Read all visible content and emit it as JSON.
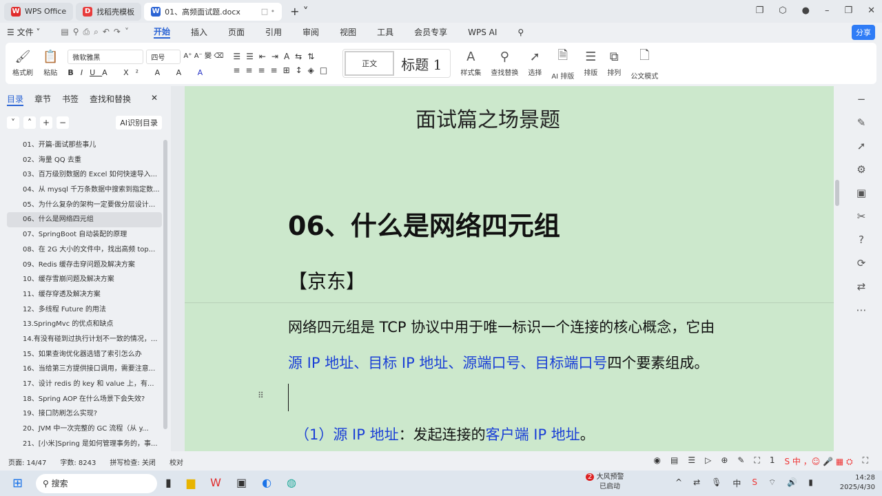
{
  "tabs": [
    {
      "label": "WPS Office",
      "color": "#e02b2b",
      "logo": "W"
    },
    {
      "label": "找稻壳模板",
      "color": "#e83c3c",
      "logo": "D"
    },
    {
      "label": "01、高频面试题.docx",
      "color": "#2a63d4",
      "logo": "W"
    }
  ],
  "menu": {
    "file": "文件",
    "items": [
      "开始",
      "插入",
      "页面",
      "引用",
      "审阅",
      "视图",
      "工具",
      "会员专享",
      "WPS AI"
    ],
    "active": "开始",
    "share": "分享"
  },
  "ribbon": {
    "format_painter": "格式刷",
    "paste": "粘贴",
    "font": "微软雅黑",
    "size": "四号",
    "style_normal": "正文",
    "style_h1": "标题 1",
    "style_set": "样式集",
    "find_replace": "查找替换",
    "select": "选择",
    "ai_layout": "AI 排版",
    "layout": "排版",
    "arrange": "排列",
    "doc_mode": "公文模式"
  },
  "sidebar": {
    "tabs": [
      "目录",
      "章节",
      "书签",
      "查找和替换"
    ],
    "ai_toc": "AI识别目录",
    "items": [
      "01、开篇-面试那些事儿",
      "02、海量 QQ 去重",
      "03、百万级别数据的 Excel 如何快速导入...",
      "04、从 mysql 千万条数据中搜索到指定数...",
      "05、为什么复杂的架构一定要做分层设计...",
      "06、什么是网络四元组",
      "07、SpringBoot 自动装配的原理",
      "08、在 2G 大小的文件中，找出高频 top...",
      "09、Redis 缓存击穿问题及解决方案",
      "10、缓存雪崩问题及解决方案",
      "11、缓存穿透及解决方案",
      "12、多线程 Future 的用法",
      "13.SpringMvc 的优点和缺点",
      "14.有没有碰到过执行计划不一致的情况，...",
      "15、如果查询优化器选错了索引怎么办",
      "16、当给第三方提供接口调用，需要注意...",
      "17、设计 redis 的 key 和 value 上，有...",
      "18、Spring AOP 在什么场景下会失效?",
      "19、接口防刷怎么实现?",
      "20、JVM 中一次完整的 GC 流程（从 y...",
      "21、[小米]Spring 是如何管理事务的，事..."
    ],
    "current_index": 5
  },
  "document": {
    "section_title": "面试篇之场景题",
    "heading": "06、什么是网络四元组",
    "company": "【京东】",
    "para1": "网络四元组是 TCP 协议中用于唯一标识一个连接的核心概念，它由",
    "para2_blue": "源 IP 地址、目标 IP 地址、源端口号、目标端口号",
    "para2_rest": "四个要素组成。",
    "item1_blue1": "（1）源 IP 地址",
    "item1_black": "：发起连接的",
    "item1_blue2": "客户端 IP 地址",
    "item1_end": "。",
    "page_bg": "#cce8cc",
    "link_color": "#1a3fd6"
  },
  "status": {
    "page": "页面: 14/47",
    "words": "字数: 8243",
    "spell": "拼写检查: 关闭",
    "proof": "校对",
    "zoom": "1"
  },
  "taskbar": {
    "search": "搜索",
    "weather_title": "大风预警",
    "weather_sub": "已启动",
    "weather_badge": "2",
    "time": "14:28",
    "date": "2025/4/30"
  }
}
